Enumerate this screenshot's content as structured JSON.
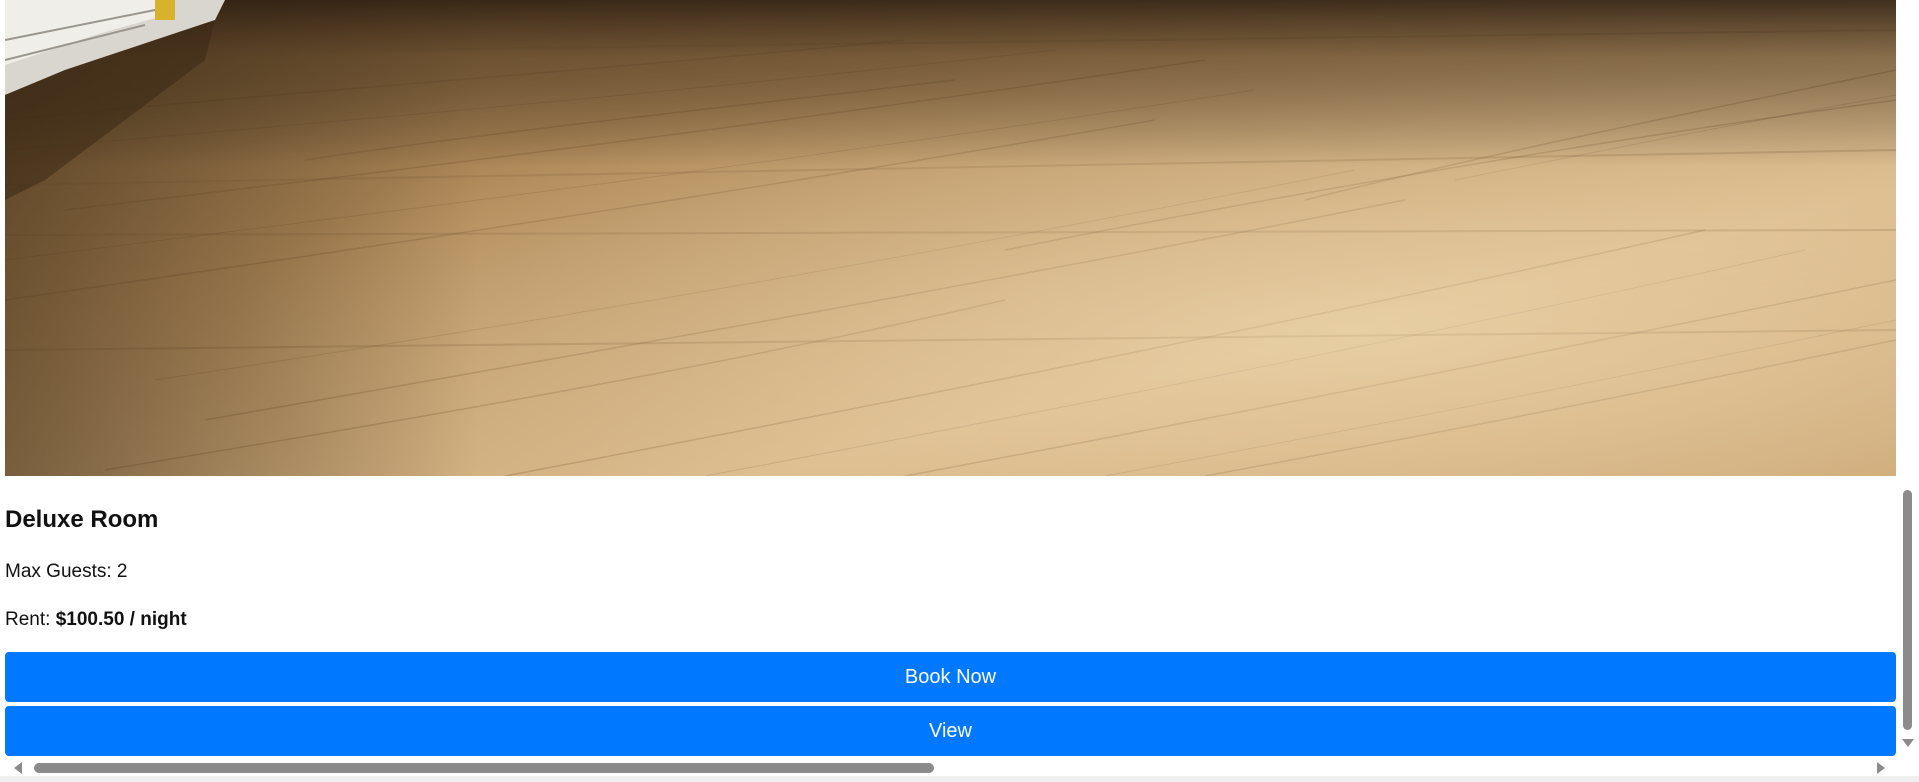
{
  "room": {
    "image_alt": "Room photo showing wooden floor",
    "title": "Deluxe Room",
    "guests_text": "Max Guests: 2",
    "rent_label": "Rent: ",
    "rent_value": "$100.50 / night"
  },
  "actions": {
    "book_label": "Book Now",
    "view_label": "View"
  },
  "colors": {
    "button_bg": "#0078ff",
    "button_text": "#ffffff",
    "scrollbar_thumb": "#8b8b8b"
  }
}
